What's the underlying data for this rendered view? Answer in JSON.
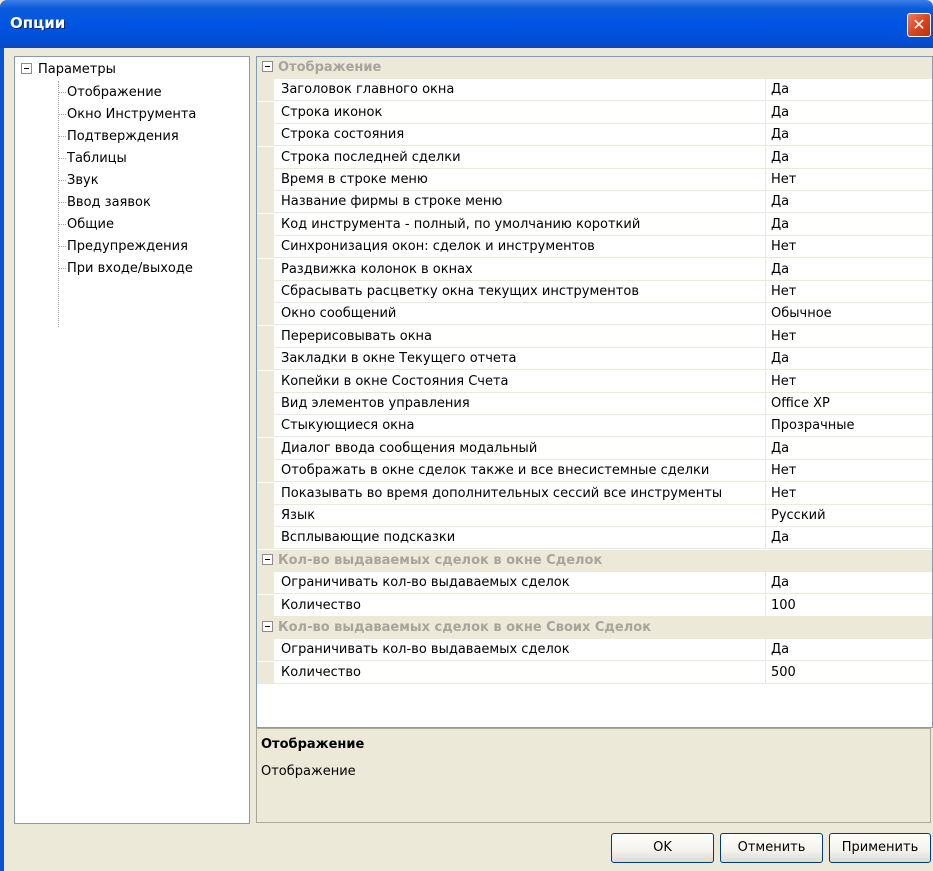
{
  "window": {
    "title": "Опции",
    "close_glyph": "✕"
  },
  "tree": {
    "root": "Параметры",
    "items": [
      "Отображение",
      "Окно Инструмента",
      "Подтверждения",
      "Таблицы",
      "Звук",
      "Ввод заявок",
      "Общие",
      "Предупреждения",
      "При входе/выходе"
    ]
  },
  "grid": {
    "categories": [
      {
        "name": "Отображение",
        "rows": [
          {
            "name": "Заголовок главного окна",
            "value": "Да"
          },
          {
            "name": "Строка иконок",
            "value": "Да"
          },
          {
            "name": "Строка состояния",
            "value": "Да"
          },
          {
            "name": "Строка последней сделки",
            "value": "Да"
          },
          {
            "name": "Время в строке меню",
            "value": "Нет"
          },
          {
            "name": "Название фирмы в строке меню",
            "value": "Да"
          },
          {
            "name": "Код инструмента - полный, по умолчанию короткий",
            "value": "Да"
          },
          {
            "name": "Синхронизация окон: сделок и инструментов",
            "value": "Нет"
          },
          {
            "name": "Раздвижка колонок в окнах",
            "value": "Да"
          },
          {
            "name": "Сбрасывать расцветку окна текущих инструментов",
            "value": "Нет"
          },
          {
            "name": "Окно сообщений",
            "value": "Обычное"
          },
          {
            "name": "Перерисовывать окна",
            "value": "Нет"
          },
          {
            "name": "Закладки в окне Текущего отчета",
            "value": "Да"
          },
          {
            "name": "Копейки в окне Состояния Счета",
            "value": "Нет"
          },
          {
            "name": "Вид элементов управления",
            "value": "Office XP"
          },
          {
            "name": "Стыкующиеся окна",
            "value": "Прозрачные"
          },
          {
            "name": "Диалог ввода сообщения модальный",
            "value": "Да"
          },
          {
            "name": "Отображать в окне сделок также и все внесистемные сделки",
            "value": "Нет"
          },
          {
            "name": "Показывать во время дополнительных сессий все инструменты",
            "value": "Нет"
          },
          {
            "name": "Язык",
            "value": "Русский"
          },
          {
            "name": "Всплывающие подсказки",
            "value": "Да"
          }
        ]
      },
      {
        "name": "Кол-во выдаваемых сделок в окне Сделок",
        "rows": [
          {
            "name": "Ограничивать кол-во выдаваемых сделок",
            "value": "Да"
          },
          {
            "name": "Количество",
            "value": "100"
          }
        ]
      },
      {
        "name": "Кол-во выдаваемых сделок в окне Своих Сделок",
        "rows": [
          {
            "name": "Ограничивать кол-во выдаваемых сделок",
            "value": "Да"
          },
          {
            "name": "Количество",
            "value": "500"
          }
        ]
      }
    ]
  },
  "description": {
    "title": "Отображение",
    "text": "Отображение"
  },
  "buttons": {
    "ok": "OK",
    "cancel": "Отменить",
    "apply": "Применить"
  },
  "colors": {
    "title_bar": "#0054e3",
    "dialog_bg": "#ece9d8",
    "category_text": "#a7a59b"
  }
}
